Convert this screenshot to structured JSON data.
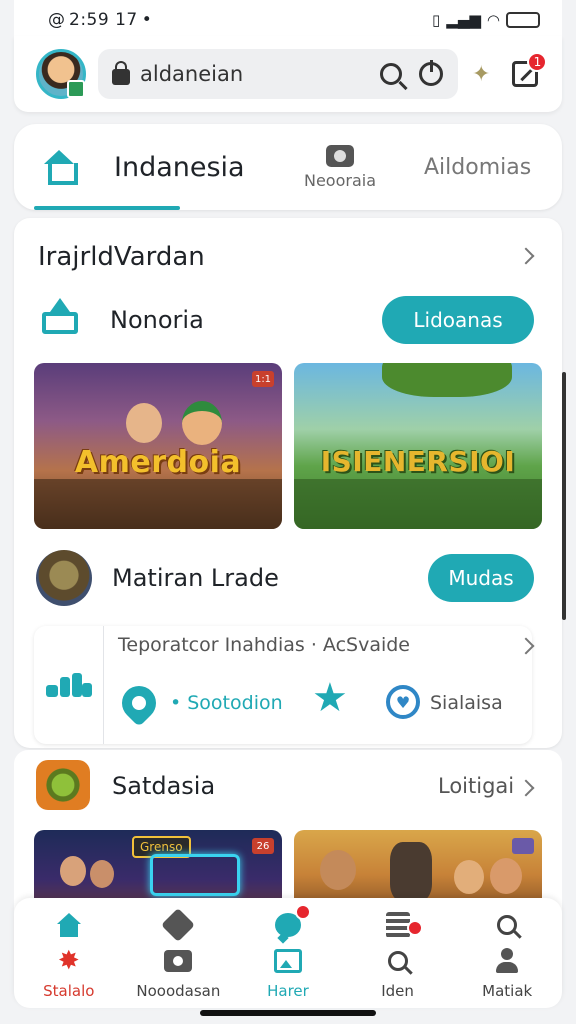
{
  "status_bar": {
    "time": "2:59 17",
    "sim": "@",
    "battery_label": ""
  },
  "header": {
    "search_text": "aldaneian",
    "notification_count": "1"
  },
  "tabs": {
    "home_label": "Indanesia",
    "middle_label": "Neooraia",
    "right_label": "Aildomias"
  },
  "feed": {
    "section_title": "IrajrldVardan",
    "row1": {
      "label": "Nonoria",
      "button_label": "Lidoanas"
    },
    "thumbnails": [
      {
        "title": "Amerdoia",
        "badge": "1:1"
      },
      {
        "title": "ISIENERSIOI",
        "badge": ""
      }
    ],
    "row2": {
      "label": "Matiran Lrade",
      "button_label": "Mudas"
    },
    "info": {
      "title": "Teporatcor Inahdias · AcSvaide",
      "link_label": "• Sootodion",
      "right_label": "Sialaisa"
    }
  },
  "section2": {
    "title": "Satdasia",
    "link_label": "Loitigai",
    "thumb3_sign": "Grenso",
    "thumb3_badge": "26"
  },
  "bottom_nav": [
    {
      "label": "Stalalo"
    },
    {
      "label": "Nooodasan"
    },
    {
      "label": "Harer"
    },
    {
      "label": "Iden"
    },
    {
      "label": "Matiak"
    }
  ],
  "colors": {
    "accent": "#20a9b4",
    "alert": "#e6262e"
  }
}
